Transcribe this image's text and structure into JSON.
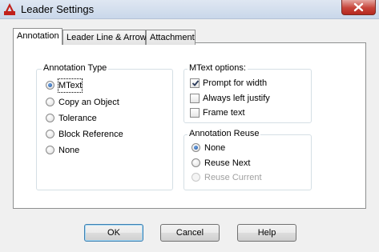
{
  "window": {
    "title": "Leader Settings",
    "app_icon": "autocad-logo-icon",
    "close_icon": "close-icon"
  },
  "tabs": [
    {
      "label": "Annotation",
      "active": true
    },
    {
      "label": "Leader Line & Arrow",
      "active": false
    },
    {
      "label": "Attachment",
      "active": false
    }
  ],
  "annotation_type": {
    "title": "Annotation Type",
    "options": [
      {
        "label": "MText",
        "checked": true
      },
      {
        "label": "Copy an Object",
        "checked": false
      },
      {
        "label": "Tolerance",
        "checked": false
      },
      {
        "label": "Block Reference",
        "checked": false
      },
      {
        "label": "None",
        "checked": false
      }
    ]
  },
  "mtext_options": {
    "title": "MText options:",
    "options": [
      {
        "label": "Prompt for width",
        "checked": true
      },
      {
        "label": "Always left justify",
        "checked": false
      },
      {
        "label": "Frame text",
        "checked": false
      }
    ]
  },
  "annotation_reuse": {
    "title": "Annotation Reuse",
    "options": [
      {
        "label": "None",
        "checked": true,
        "enabled": true
      },
      {
        "label": "Reuse Next",
        "checked": false,
        "enabled": true
      },
      {
        "label": "Reuse Current",
        "checked": false,
        "enabled": false
      }
    ]
  },
  "buttons": {
    "ok": "OK",
    "cancel": "Cancel",
    "help": "Help"
  },
  "colors": {
    "accent": "#3c7fb1",
    "close_button": "#c7443a",
    "app_icon": "#c0201b"
  }
}
